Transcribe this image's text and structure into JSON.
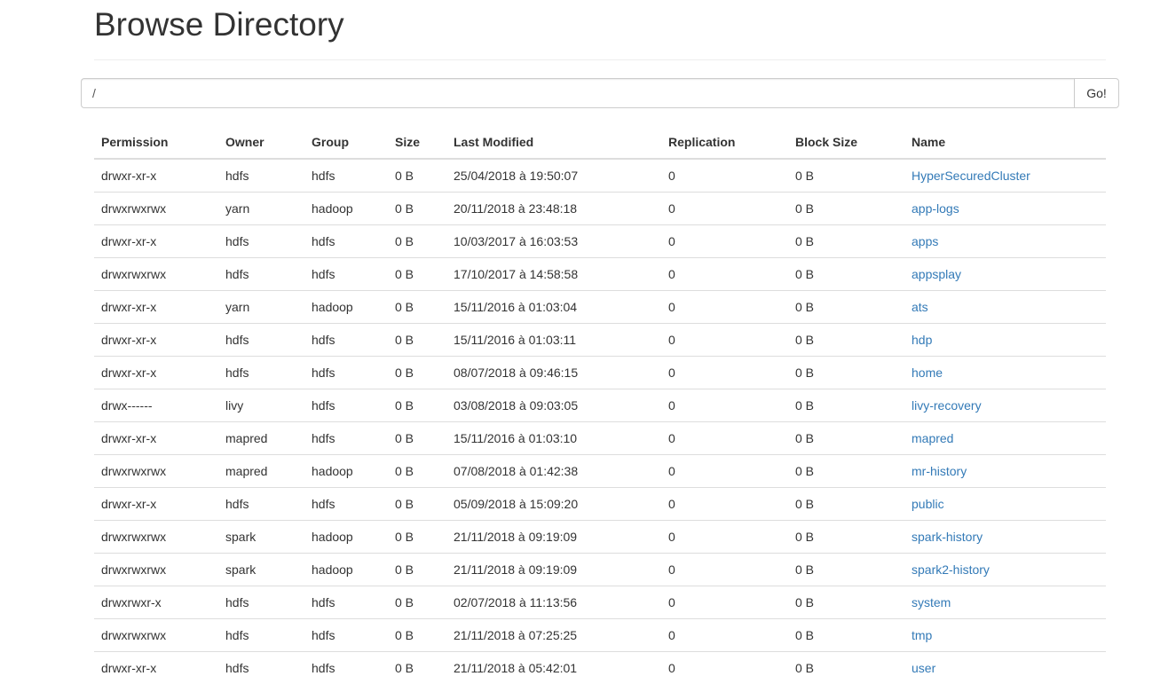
{
  "header": {
    "title": "Browse Directory"
  },
  "path_bar": {
    "value": "/",
    "go_label": "Go!"
  },
  "table": {
    "columns": [
      "Permission",
      "Owner",
      "Group",
      "Size",
      "Last Modified",
      "Replication",
      "Block Size",
      "Name"
    ],
    "rows": [
      {
        "permission": "drwxr-xr-x",
        "owner": "hdfs",
        "group": "hdfs",
        "size": "0 B",
        "modified": "25/04/2018 à 19:50:07",
        "replication": "0",
        "block_size": "0 B",
        "name": "HyperSecuredCluster"
      },
      {
        "permission": "drwxrwxrwx",
        "owner": "yarn",
        "group": "hadoop",
        "size": "0 B",
        "modified": "20/11/2018 à 23:48:18",
        "replication": "0",
        "block_size": "0 B",
        "name": "app-logs"
      },
      {
        "permission": "drwxr-xr-x",
        "owner": "hdfs",
        "group": "hdfs",
        "size": "0 B",
        "modified": "10/03/2017 à 16:03:53",
        "replication": "0",
        "block_size": "0 B",
        "name": "apps"
      },
      {
        "permission": "drwxrwxrwx",
        "owner": "hdfs",
        "group": "hdfs",
        "size": "0 B",
        "modified": "17/10/2017 à 14:58:58",
        "replication": "0",
        "block_size": "0 B",
        "name": "appsplay"
      },
      {
        "permission": "drwxr-xr-x",
        "owner": "yarn",
        "group": "hadoop",
        "size": "0 B",
        "modified": "15/11/2016 à 01:03:04",
        "replication": "0",
        "block_size": "0 B",
        "name": "ats"
      },
      {
        "permission": "drwxr-xr-x",
        "owner": "hdfs",
        "group": "hdfs",
        "size": "0 B",
        "modified": "15/11/2016 à 01:03:11",
        "replication": "0",
        "block_size": "0 B",
        "name": "hdp"
      },
      {
        "permission": "drwxr-xr-x",
        "owner": "hdfs",
        "group": "hdfs",
        "size": "0 B",
        "modified": "08/07/2018 à 09:46:15",
        "replication": "0",
        "block_size": "0 B",
        "name": "home"
      },
      {
        "permission": "drwx------",
        "owner": "livy",
        "group": "hdfs",
        "size": "0 B",
        "modified": "03/08/2018 à 09:03:05",
        "replication": "0",
        "block_size": "0 B",
        "name": "livy-recovery"
      },
      {
        "permission": "drwxr-xr-x",
        "owner": "mapred",
        "group": "hdfs",
        "size": "0 B",
        "modified": "15/11/2016 à 01:03:10",
        "replication": "0",
        "block_size": "0 B",
        "name": "mapred"
      },
      {
        "permission": "drwxrwxrwx",
        "owner": "mapred",
        "group": "hadoop",
        "size": "0 B",
        "modified": "07/08/2018 à 01:42:38",
        "replication": "0",
        "block_size": "0 B",
        "name": "mr-history"
      },
      {
        "permission": "drwxr-xr-x",
        "owner": "hdfs",
        "group": "hdfs",
        "size": "0 B",
        "modified": "05/09/2018 à 15:09:20",
        "replication": "0",
        "block_size": "0 B",
        "name": "public"
      },
      {
        "permission": "drwxrwxrwx",
        "owner": "spark",
        "group": "hadoop",
        "size": "0 B",
        "modified": "21/11/2018 à 09:19:09",
        "replication": "0",
        "block_size": "0 B",
        "name": "spark-history"
      },
      {
        "permission": "drwxrwxrwx",
        "owner": "spark",
        "group": "hadoop",
        "size": "0 B",
        "modified": "21/11/2018 à 09:19:09",
        "replication": "0",
        "block_size": "0 B",
        "name": "spark2-history"
      },
      {
        "permission": "drwxrwxr-x",
        "owner": "hdfs",
        "group": "hdfs",
        "size": "0 B",
        "modified": "02/07/2018 à 11:13:56",
        "replication": "0",
        "block_size": "0 B",
        "name": "system"
      },
      {
        "permission": "drwxrwxrwx",
        "owner": "hdfs",
        "group": "hdfs",
        "size": "0 B",
        "modified": "21/11/2018 à 07:25:25",
        "replication": "0",
        "block_size": "0 B",
        "name": "tmp"
      },
      {
        "permission": "drwxr-xr-x",
        "owner": "hdfs",
        "group": "hdfs",
        "size": "0 B",
        "modified": "21/11/2018 à 05:42:01",
        "replication": "0",
        "block_size": "0 B",
        "name": "user"
      }
    ]
  },
  "colors": {
    "link": "#337ab7",
    "text": "#333333",
    "border": "#dddddd"
  }
}
